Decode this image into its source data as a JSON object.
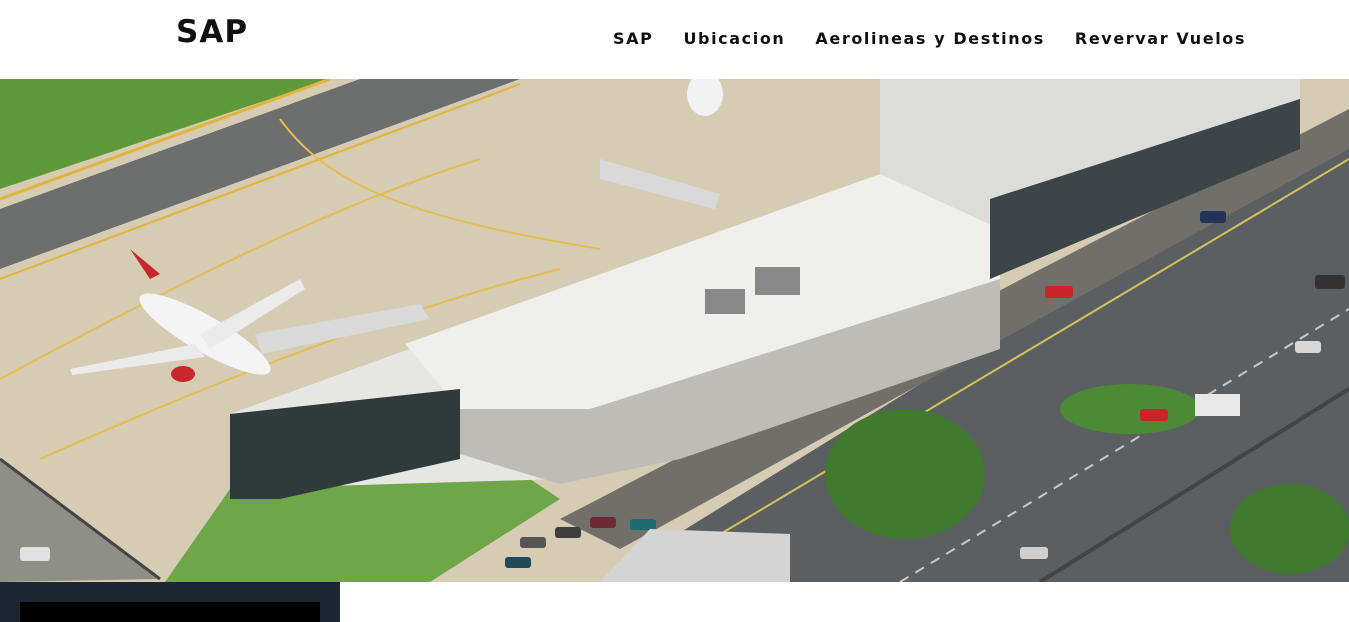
{
  "header": {
    "brand": "SAP",
    "nav": [
      {
        "label": "SAP"
      },
      {
        "label": "Ubicacion"
      },
      {
        "label": "Aerolineas y Destinos"
      },
      {
        "label": "Revervar Vuelos"
      }
    ]
  },
  "hero": {
    "subject": "aerial photo of airport terminal",
    "colors": {
      "grass": "#5f9a3a",
      "apron": "#d8cdb6",
      "roof": "#e8e8e4",
      "road": "#5c5f61"
    }
  }
}
